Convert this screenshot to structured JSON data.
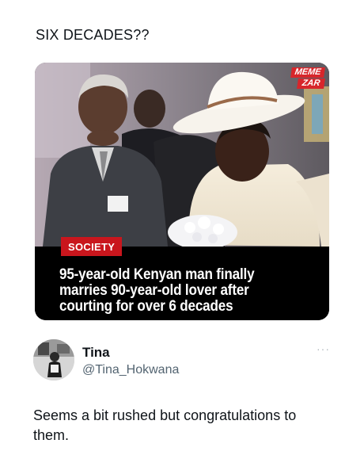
{
  "post": {
    "caption": "SIX DECADES??"
  },
  "media": {
    "watermark_line1": "MEME",
    "watermark_line2": "ZAR",
    "tag": "SOCIETY",
    "headline": "95-year-old Kenyan man finally marries 90-year-old lover after courting for over 6 decades",
    "icon": "news-photo"
  },
  "reply": {
    "name": "Tina",
    "handle": "@Tina_Hokwana",
    "text": "Seems a bit rushed but congratulations to them.",
    "more_icon": "more-options-icon"
  },
  "colors": {
    "tag_red": "#c9161d",
    "watermark_red": "#d7262b",
    "handle_gray": "#536471",
    "text_dark": "#0f1419"
  }
}
